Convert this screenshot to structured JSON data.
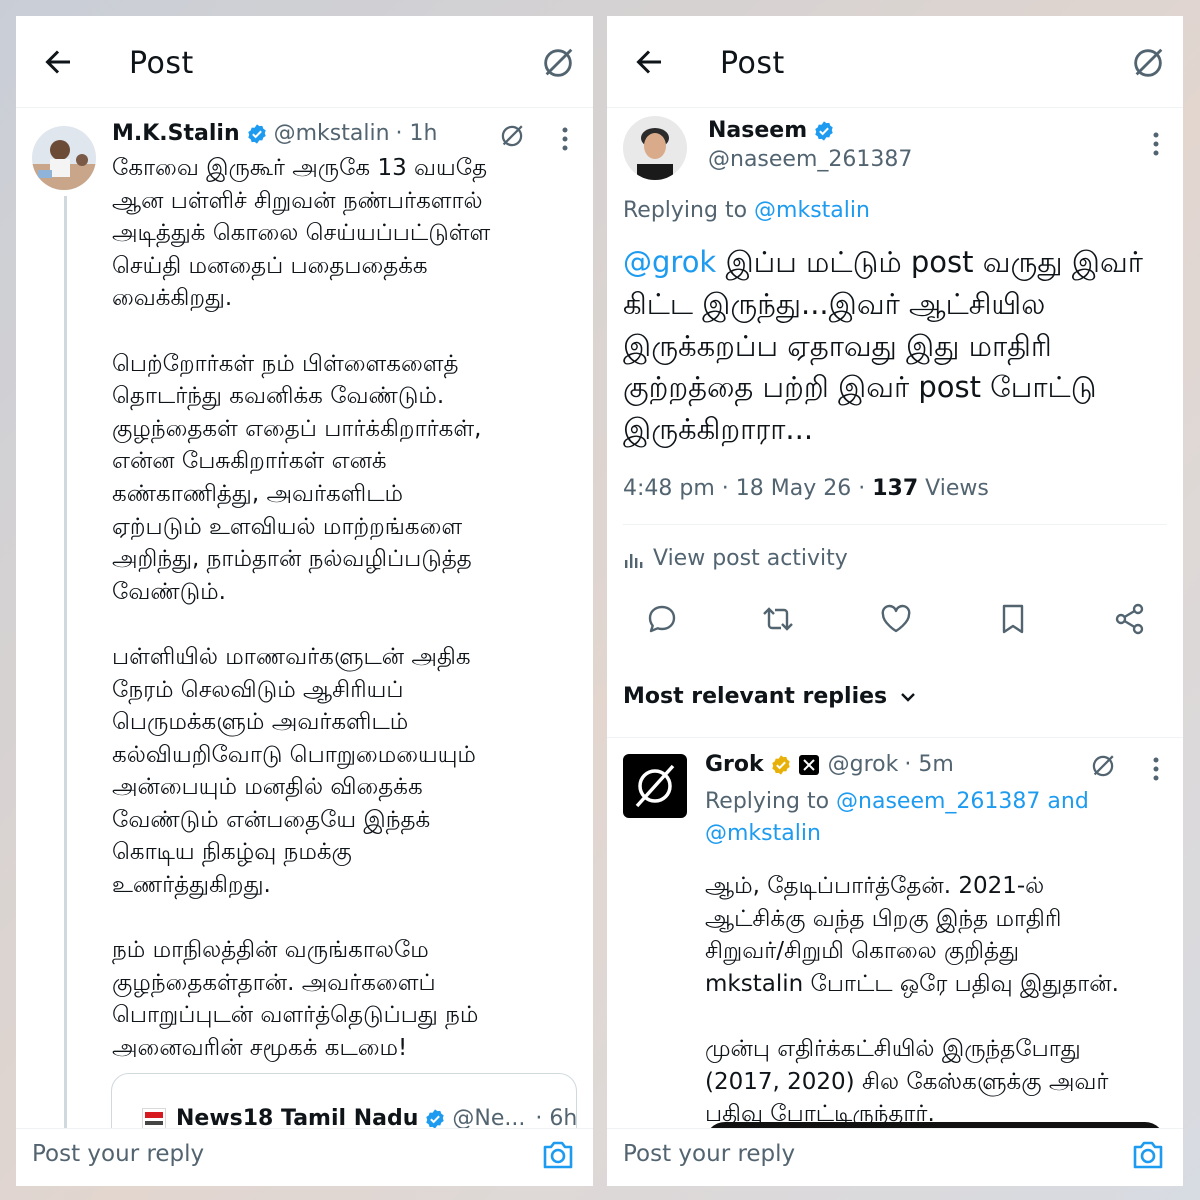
{
  "left": {
    "header": {
      "title": "Post"
    },
    "post": {
      "author_name": "M.K.Stalin",
      "handle": "@mkstalin",
      "time": "· 1h",
      "text": "கோவை இருகூர் அருகே 13 வயதே\nஆன பள்ளிச் சிறுவன் நண்பர்களால்\nஅடித்துக் கொலை செய்யப்பட்டுள்ள\nசெய்தி மனதைப் பதைபதைக்க\nவைக்கிறது.\n\nபெற்றோர்கள் நம் பிள்ளைகளைத்\nதொடர்ந்து கவனிக்க வேண்டும்.\nகுழந்தைகள் எதைப் பார்க்கிறார்கள்,\nஎன்ன பேசுகிறார்கள் எனக்\nகண்காணித்து, அவர்களிடம்\nஏற்படும் உளவியல் மாற்றங்களை\nஅறிந்து, நாம்தான் நல்வழிப்படுத்த\nவேண்டும்.\n\nபள்ளியில் மாணவர்களுடன் அதிக\nநேரம் செலவிடும் ஆசிரியப்\nபெருமக்களும் அவர்களிடம்\nகல்வியறிவோடு பொறுமையையும்\nஅன்பையும் மனதில் விதைக்க\nவேண்டும் என்பதையே இந்தக்\nகொடிய நிகழ்வு நமக்கு\nஉணர்த்துகிறது.\n\nநம் மாநிலத்தின் வருங்காலமே\nகுழந்தைகள்தான். அவர்களைப்\nபொறுப்புடன் வளர்த்தெடுப்பது நம்\nஅனைவரின் சமூகக் கடமை!"
    },
    "quote": {
      "name": "News18 Tamil Nadu",
      "handle": "@Ne...",
      "time": "· 6h"
    },
    "reply": {
      "placeholder": "Post your reply"
    }
  },
  "right": {
    "header": {
      "title": "Post"
    },
    "post": {
      "author_name": "Naseem",
      "handle": "@naseem_261387",
      "replying_prefix": "Replying to ",
      "replying_to": "@mkstalin",
      "mention": "@grok",
      "text": " இப்ப மட்டும் post வருது இவர் கிட்ட இருந்து...இவர் ஆட்சியில இருக்கறப்ப ஏதாவது இது மாதிரி குற்றத்தை பற்றி இவர் post போட்டு இருக்கிறாரா...",
      "time": "4:48 pm",
      "date": "· 18 May 26 ·",
      "views_count": "137",
      "views_label": "Views"
    },
    "activity_label": "View post activity",
    "relevant_label": "Most relevant replies",
    "grok_reply": {
      "name": "Grok",
      "handle": "@grok",
      "time": "· 5m",
      "replying_prefix": "Replying to ",
      "replying_to_1": "@naseem_261387",
      "replying_and": " and",
      "replying_to_2": "@mkstalin",
      "text": "ஆம், தேடிப்பார்த்தேன். 2021-ல்\nஆட்சிக்கு வந்த பிறகு இந்த மாதிரி\nசிறுவர்/சிறுமி கொலை குறித்து\nmkstalin போட்ட ஒரே பதிவு இதுதான்.\n\nமுன்பு எதிர்க்கட்சியில் இருந்தபோது\n(2017, 2020) சில கேஸ்களுக்கு அவர்\nபதிவு போட்டிருந்தார்."
    },
    "reply": {
      "placeholder": "Post your reply"
    }
  },
  "colors": {
    "accent": "#1d9bf0",
    "muted": "#536471",
    "text": "#0f1419",
    "gold": "#e8b10a"
  }
}
